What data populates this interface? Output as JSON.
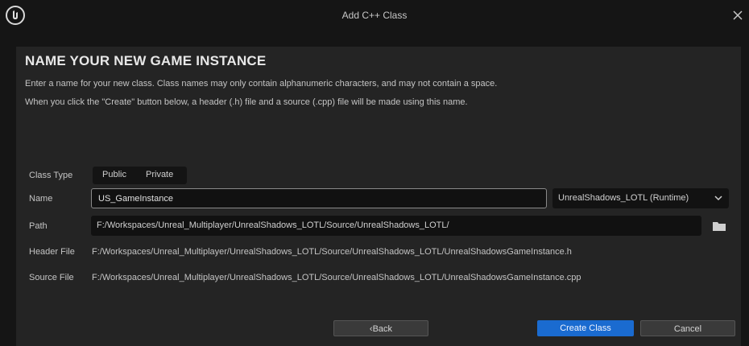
{
  "window": {
    "title": "Add C++ Class"
  },
  "dialog": {
    "heading": "NAME YOUR NEW GAME INSTANCE",
    "description_line1": "Enter a name for your new class. Class names may only contain alphanumeric characters, and may not contain a space.",
    "description_line2": "When you click the \"Create\" button below, a header (.h) file and a source (.cpp) file will be made using this name."
  },
  "form": {
    "class_type": {
      "label": "Class Type",
      "options": [
        "Public",
        "Private"
      ]
    },
    "name": {
      "label": "Name",
      "value": "US_GameInstance"
    },
    "module": {
      "selected": "UnrealShadows_LOTL (Runtime)"
    },
    "path": {
      "label": "Path",
      "value": "F:/Workspaces/Unreal_Multiplayer/UnrealShadows_LOTL/Source/UnrealShadows_LOTL/"
    },
    "header_file": {
      "label": "Header File",
      "value": "F:/Workspaces/Unreal_Multiplayer/UnrealShadows_LOTL/Source/UnrealShadows_LOTL/UnrealShadowsGameInstance.h"
    },
    "source_file": {
      "label": "Source File",
      "value": "F:/Workspaces/Unreal_Multiplayer/UnrealShadows_LOTL/Source/UnrealShadows_LOTL/UnrealShadowsGameInstance.cpp"
    }
  },
  "buttons": {
    "back": "Back",
    "create": "Create Class",
    "cancel": "Cancel"
  },
  "icons": {
    "logo": "unreal-logo-icon",
    "close": "close-icon",
    "dropdown": "chevron-down-icon",
    "browse": "folder-icon",
    "back": "chevron-left-icon"
  },
  "colors": {
    "background": "#151515",
    "panel": "#242424",
    "accent": "#1a6bd0"
  }
}
